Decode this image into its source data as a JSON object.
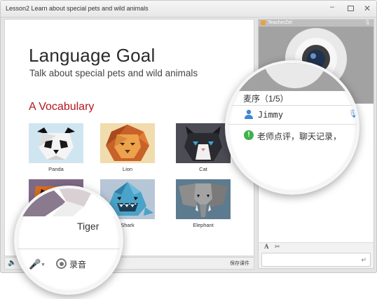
{
  "window": {
    "title": "Lesson2 Learn about special pets and wild animals",
    "controls": [
      "minimize",
      "maximize",
      "close"
    ]
  },
  "slide": {
    "heading": "Language Goal",
    "subheading": "Talk about special pets and wild animals",
    "section": "A Vocabulary",
    "section_color": "#b4161f",
    "cards": [
      {
        "label": "Panda",
        "icon": "panda-image"
      },
      {
        "label": "Lion",
        "icon": "lion-image"
      },
      {
        "label": "Cat",
        "icon": "cat-image"
      },
      {
        "label": "",
        "icon": "tiger-image"
      },
      {
        "label": "Shark",
        "icon": "shark-image"
      },
      {
        "label": "Elephant",
        "icon": "elephant-image"
      }
    ]
  },
  "bottom_bar": {
    "save_label": "保存课件"
  },
  "sidebar": {
    "teacher_name": "TeacherZel",
    "tools": [
      "A",
      "✂"
    ]
  },
  "magnifier_left": {
    "caption": "Tiger",
    "record_label": "录音"
  },
  "magnifier_right": {
    "queue_label": "麦序（1/5）",
    "user_name": "Jimmy",
    "notice": "老师点评，聊天记录，"
  }
}
